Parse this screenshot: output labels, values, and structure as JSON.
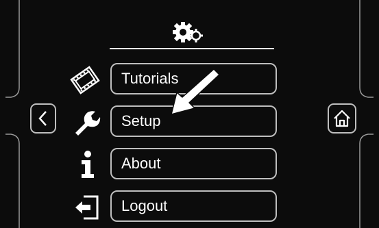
{
  "menu": {
    "items": [
      {
        "label": "Tutorials",
        "icon": "film-icon"
      },
      {
        "label": "Setup",
        "icon": "wrench-icon"
      },
      {
        "label": "About",
        "icon": "info-icon"
      },
      {
        "label": "Logout",
        "icon": "logout-icon"
      }
    ]
  },
  "header": {
    "icon": "gears-icon"
  },
  "nav": {
    "back_icon": "chevron-left-icon",
    "home_icon": "home-icon"
  },
  "colors": {
    "background": "#0c0c0c",
    "border": "#bfbfbf",
    "text": "#ffffff"
  }
}
